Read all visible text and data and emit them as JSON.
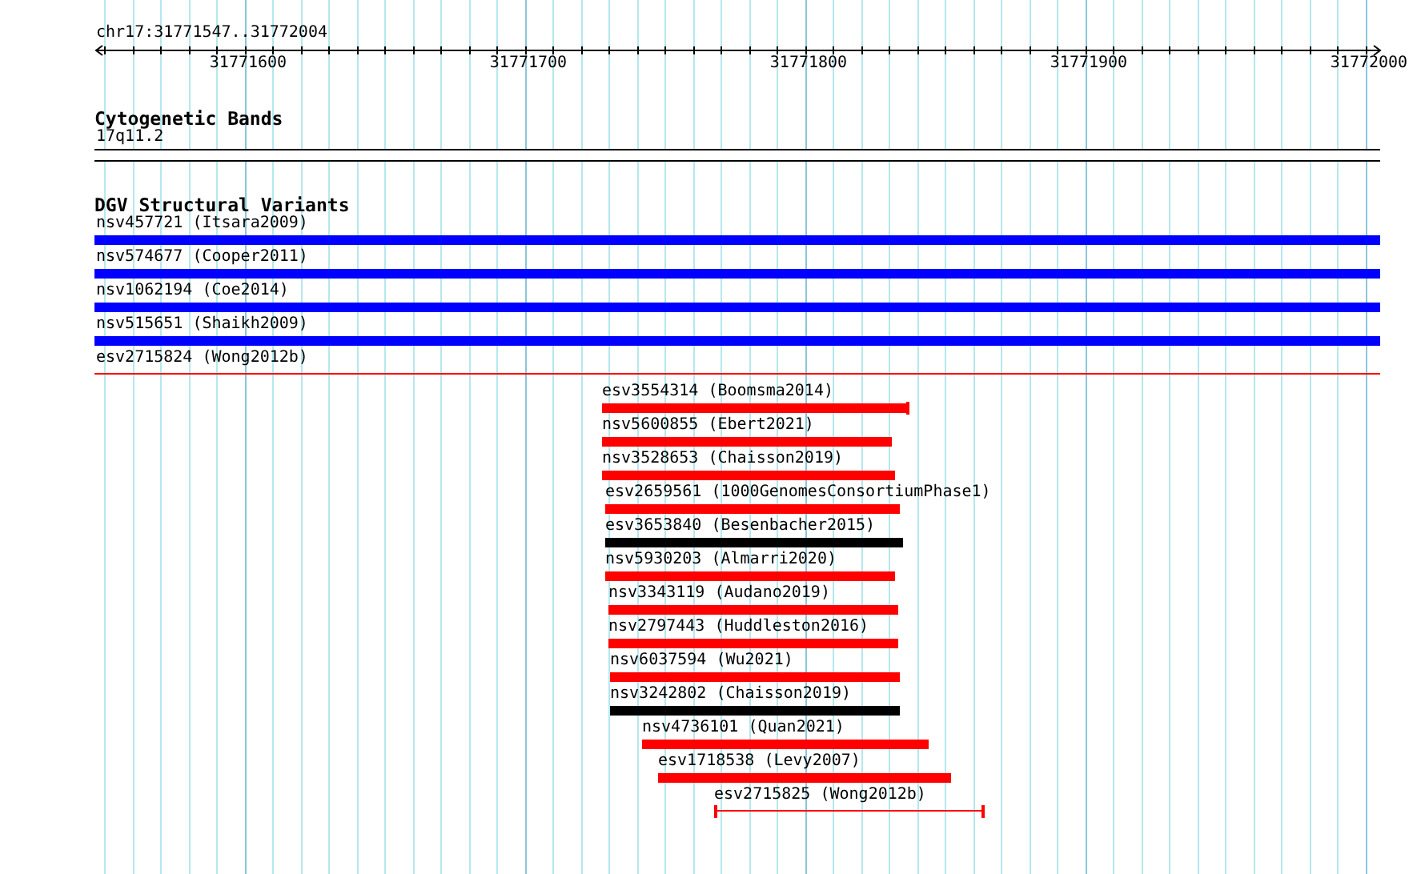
{
  "ruler": {
    "location": "chr17:31771547..31772004",
    "ticks": [
      {
        "label": "31771600"
      },
      {
        "label": "31771700"
      },
      {
        "label": "31771800"
      },
      {
        "label": "31771900"
      },
      {
        "label": "31772000"
      }
    ]
  },
  "cytogenetic_bands": {
    "title": "Cytogenetic Bands",
    "features": [
      {
        "label": "17q11.2",
        "kind": "band",
        "color": "#ffffff"
      }
    ]
  },
  "structural_variants": {
    "title": "DGV Structural Variants",
    "features": [
      {
        "label": "nsv457721 (Itsara2009)",
        "kind": "bar",
        "color": "#0000ff"
      },
      {
        "label": "nsv574677 (Cooper2011)",
        "kind": "bar",
        "color": "#0000ff"
      },
      {
        "label": "nsv1062194 (Coe2014)",
        "kind": "bar",
        "color": "#0000ff"
      },
      {
        "label": "nsv515651 (Shaikh2009)",
        "kind": "bar",
        "color": "#0000ff"
      },
      {
        "label": "esv2715824 (Wong2012b)",
        "kind": "line",
        "color": "#ff0000"
      },
      {
        "label": "esv3554314 (Boomsma2014)",
        "kind": "bar_end_cap",
        "color": "#ff0000"
      },
      {
        "label": "nsv5600855 (Ebert2021)",
        "kind": "bar",
        "color": "#ff0000"
      },
      {
        "label": "nsv3528653 (Chaisson2019)",
        "kind": "bar",
        "color": "#ff0000"
      },
      {
        "label": "esv2659561 (1000GenomesConsortiumPhase1)",
        "kind": "bar",
        "color": "#ff0000"
      },
      {
        "label": "esv3653840 (Besenbacher2015)",
        "kind": "bar",
        "color": "#000000"
      },
      {
        "label": "nsv5930203 (Almarri2020)",
        "kind": "bar",
        "color": "#ff0000"
      },
      {
        "label": "nsv3343119 (Audano2019)",
        "kind": "bar",
        "color": "#ff0000"
      },
      {
        "label": "nsv2797443 (Huddleston2016)",
        "kind": "bar",
        "color": "#ff0000"
      },
      {
        "label": "nsv6037594 (Wu2021)",
        "kind": "bar",
        "color": "#ff0000"
      },
      {
        "label": "nsv3242802 (Chaisson2019)",
        "kind": "bar",
        "color": "#000000"
      },
      {
        "label": "nsv4736101 (Quan2021)",
        "kind": "bar",
        "color": "#ff0000"
      },
      {
        "label": "esv1718538 (Levy2007)",
        "kind": "bar",
        "color": "#ff0000"
      },
      {
        "label": "esv2715825 (Wong2012b)",
        "kind": "capped_line",
        "color": "#ff0000"
      }
    ]
  }
}
